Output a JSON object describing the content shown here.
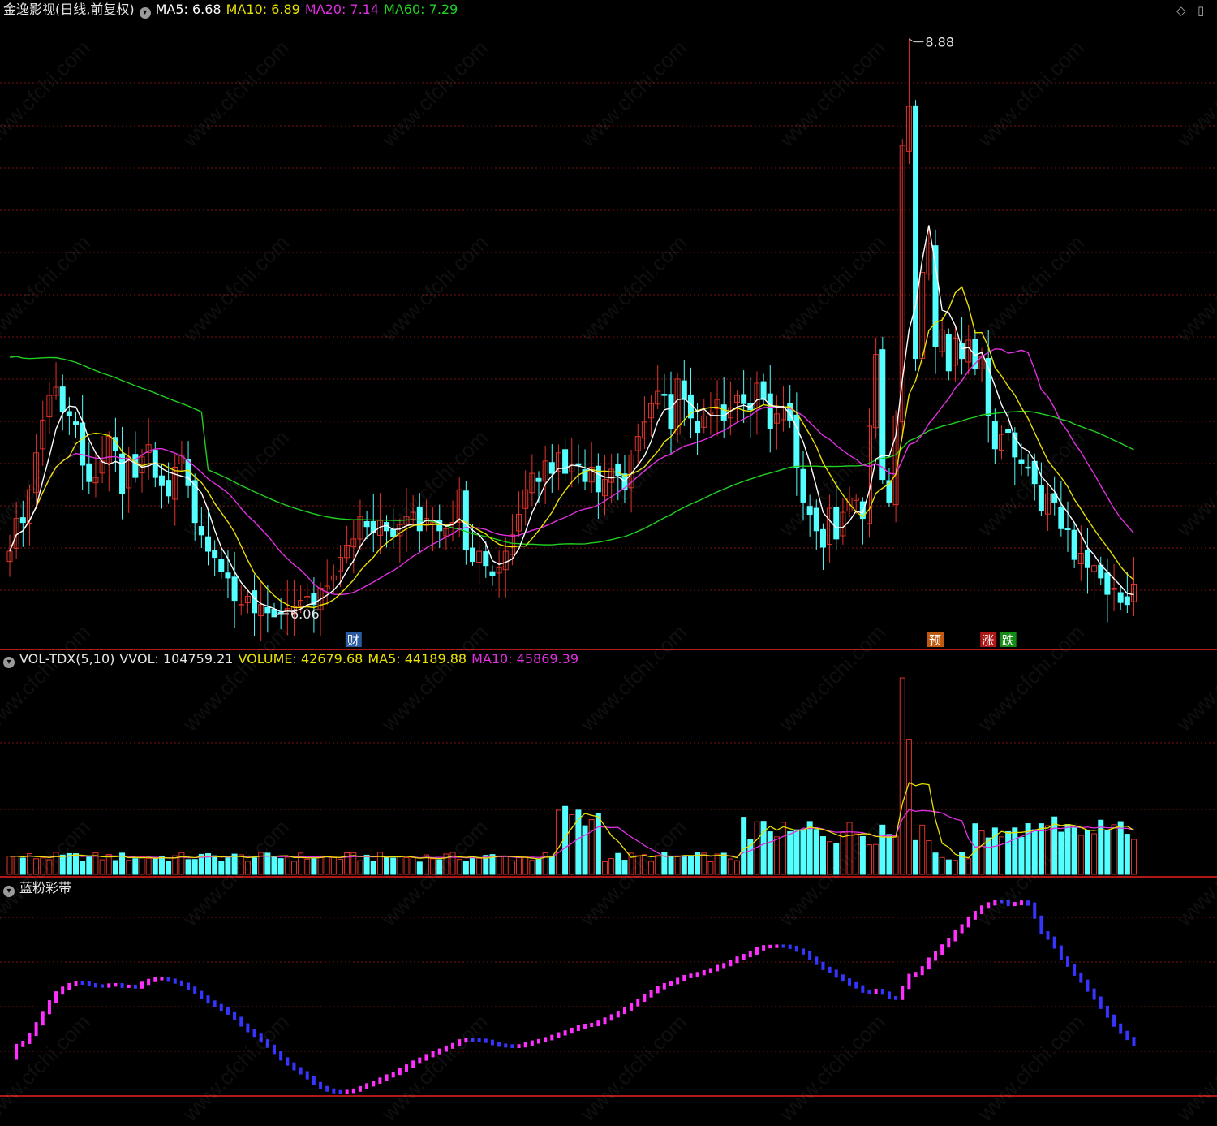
{
  "header": {
    "title": "金逸影视(日线,前复权)",
    "ma5": "MA5: 6.68",
    "ma10": "MA10: 6.89",
    "ma20": "MA20: 7.14",
    "ma60": "MA60: 7.29"
  },
  "volume_header": {
    "name": "VOL-TDX(5,10)",
    "vvol": "VVOL: 104759.21",
    "volume": "VOLUME: 42679.68",
    "ma5": "MA5: 44189.88",
    "ma10": "MA10: 45869.39"
  },
  "band_header": {
    "name": "蓝粉彩带"
  },
  "markers": {
    "high_label": "8.88",
    "low_label": "6.06",
    "tag_cai": "财",
    "tag_yu": "预",
    "tag_zhang": "涨",
    "tag_die": "跌"
  },
  "watermark": "www.cfchi.com",
  "colors": {
    "up": "#e0332a",
    "down": "#54ffff",
    "ma5": "#ffffff",
    "ma10": "#e8e000",
    "ma20": "#e030e0",
    "ma60": "#20d020",
    "band_up": "#ff30ff",
    "band_down": "#3535ff",
    "grid": "#7a1414"
  },
  "chart_data": {
    "type": "candlestick",
    "price_range": [
      6.0,
      8.95
    ],
    "series": {
      "close": [
        6.38,
        6.54,
        6.52,
        6.68,
        6.86,
        7.02,
        7.14,
        7.18,
        7.06,
        7.04,
        7.0,
        6.8,
        6.72,
        6.74,
        6.82,
        6.94,
        6.87,
        6.66,
        6.84,
        6.74,
        6.84,
        6.9,
        6.74,
        6.7,
        6.65,
        6.79,
        6.85,
        6.7,
        6.52,
        6.46,
        6.38,
        6.35,
        6.28,
        6.25,
        6.14,
        6.12,
        6.16,
        6.08,
        6.12,
        6.08,
        6.06,
        6.08,
        6.1,
        6.11,
        6.14,
        6.16,
        6.12,
        6.2,
        6.21,
        6.26,
        6.35,
        6.41,
        6.44,
        6.55,
        6.5,
        6.47,
        6.53,
        6.48,
        6.45,
        6.51,
        6.55,
        6.57,
        6.48,
        6.54,
        6.52,
        6.48,
        6.49,
        6.52,
        6.68,
        6.39,
        6.33,
        6.38,
        6.31,
        6.26,
        6.3,
        6.38,
        6.46,
        6.56,
        6.68,
        6.76,
        6.72,
        6.82,
        6.76,
        6.86,
        6.76,
        6.8,
        6.8,
        6.72,
        6.79,
        6.67,
        6.73,
        6.78,
        6.75,
        6.68,
        6.85,
        6.94,
        7.01,
        7.1,
        7.16,
        7.14,
        6.98,
        7.22,
        7.12,
        7.03,
        6.96,
        7.04,
        7.06,
        7.12,
        7.02,
        7.08,
        7.14,
        7.1,
        7.07,
        7.2,
        7.12,
        6.98,
        7.05,
        7.08,
        7.02,
        6.79,
        6.62,
        6.56,
        6.48,
        6.4,
        6.59,
        6.44,
        6.57,
        6.64,
        6.64,
        6.54,
        6.99,
        7.34,
        6.73,
        6.62,
        7.04,
        8.36,
        8.55,
        7.32,
        7.74,
        7.88,
        7.38,
        7.46,
        7.26,
        7.42,
        7.32,
        7.41,
        7.27,
        7.33,
        7.04,
        6.88,
        6.95,
        6.96,
        6.84,
        6.81,
        6.79,
        6.71,
        6.58,
        6.66,
        6.62,
        6.49,
        6.49,
        6.34,
        6.37,
        6.3,
        6.31,
        6.25,
        6.17,
        6.2,
        6.13,
        6.12,
        6.22
      ]
    },
    "ma_lines": [
      "MA5",
      "MA10",
      "MA20",
      "MA60"
    ],
    "markers": {
      "max": 8.88,
      "min": 6.06
    },
    "volume_panel": {
      "latest_volume": 42679.68,
      "ma5": 44189.88,
      "ma10": 45869.39,
      "vvol": 104759.21
    },
    "band_panel": {
      "name": "蓝粉彩带"
    }
  }
}
